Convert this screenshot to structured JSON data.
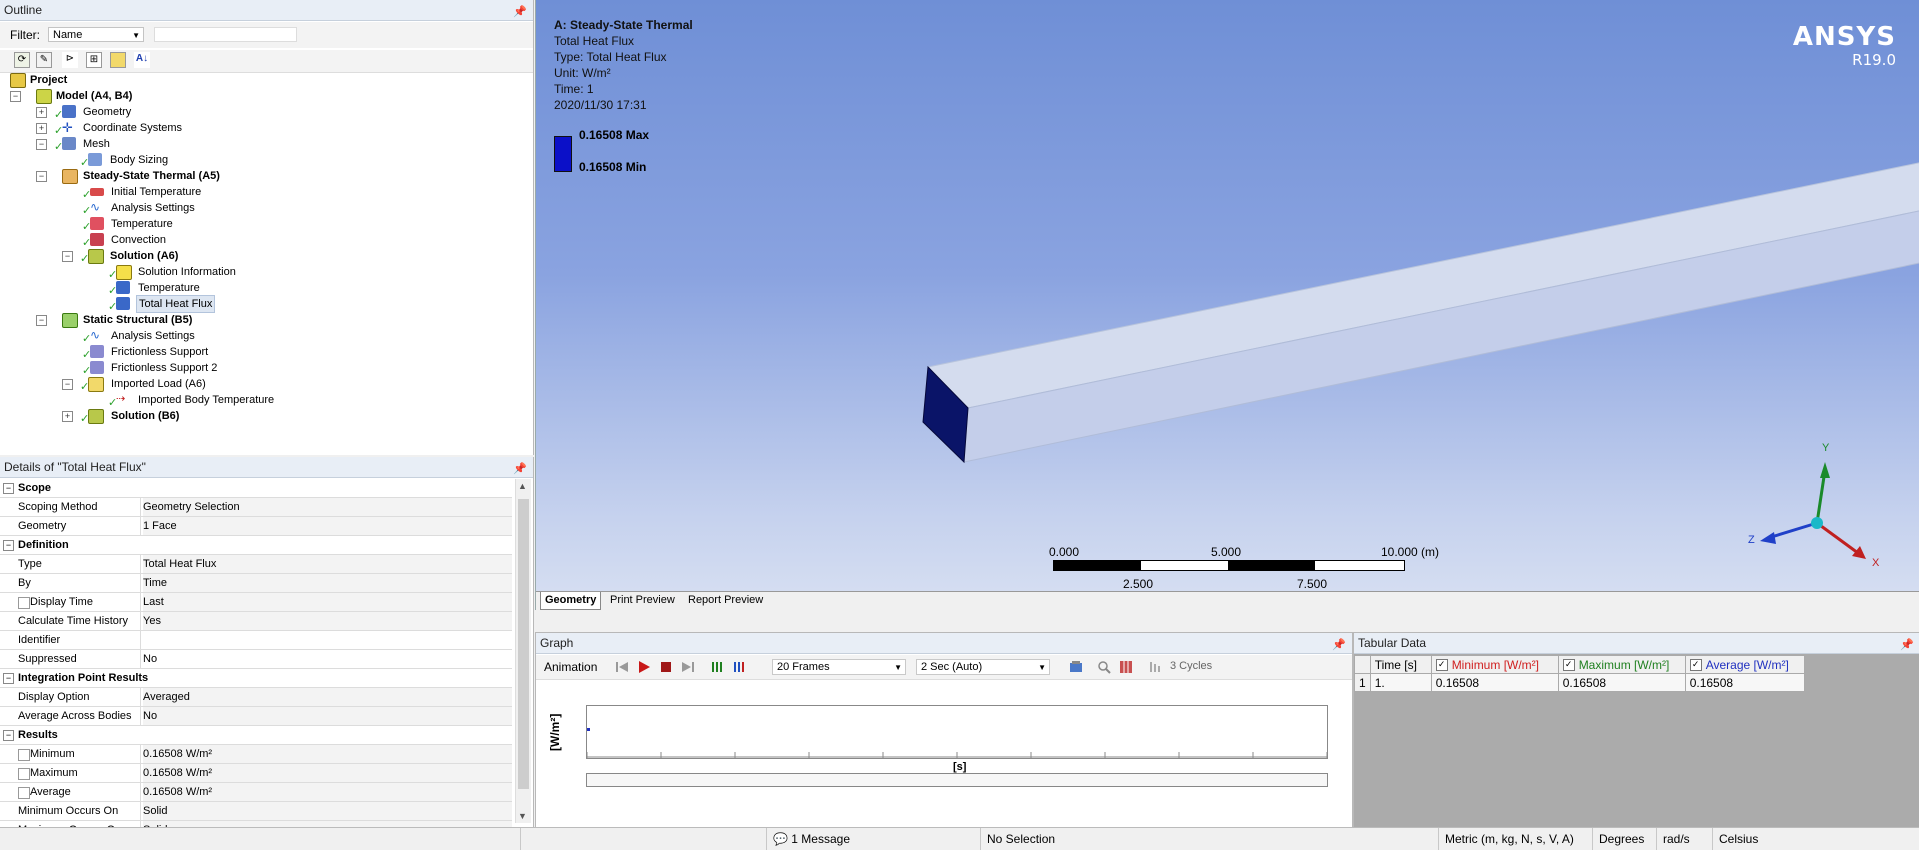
{
  "outline": {
    "title": "Outline",
    "filter_label": "Filter:",
    "filter_value": "Name",
    "tree": [
      {
        "label": "Project",
        "bold": true
      },
      {
        "label": "Model (A4, B4)",
        "bold": true
      },
      {
        "label": "Geometry"
      },
      {
        "label": "Coordinate Systems"
      },
      {
        "label": "Mesh"
      },
      {
        "label": "Body Sizing"
      },
      {
        "label": "Steady-State Thermal (A5)",
        "bold": true
      },
      {
        "label": "Initial Temperature"
      },
      {
        "label": "Analysis Settings"
      },
      {
        "label": "Temperature"
      },
      {
        "label": "Convection"
      },
      {
        "label": "Solution (A6)",
        "bold": true
      },
      {
        "label": "Solution Information"
      },
      {
        "label": "Temperature"
      },
      {
        "label": "Total Heat Flux"
      },
      {
        "label": "Static Structural (B5)",
        "bold": true
      },
      {
        "label": "Analysis Settings"
      },
      {
        "label": "Frictionless Support"
      },
      {
        "label": "Frictionless Support 2"
      },
      {
        "label": "Imported Load (A6)"
      },
      {
        "label": "Imported Body Temperature"
      },
      {
        "label": "Solution (B6)",
        "bold": true
      }
    ]
  },
  "details": {
    "title": "Details of \"Total Heat Flux\"",
    "rows": [
      {
        "section": "Scope"
      },
      {
        "key": "Scoping Method",
        "value": "Geometry Selection"
      },
      {
        "key": "Geometry",
        "value": "1 Face"
      },
      {
        "section": "Definition"
      },
      {
        "key": "Type",
        "value": "Total Heat Flux"
      },
      {
        "key": "By",
        "value": "Time"
      },
      {
        "key": "Display Time",
        "value": "Last",
        "checkbox": true
      },
      {
        "key": "Calculate Time History",
        "value": "Yes"
      },
      {
        "key": "Identifier",
        "value": ""
      },
      {
        "key": "Suppressed",
        "value": "No"
      },
      {
        "section": "Integration Point Results"
      },
      {
        "key": "Display Option",
        "value": "Averaged"
      },
      {
        "key": "Average Across Bodies",
        "value": "No"
      },
      {
        "section": "Results"
      },
      {
        "key": "Minimum",
        "value": "0.16508 W/m²",
        "checkbox": true
      },
      {
        "key": "Maximum",
        "value": "0.16508 W/m²",
        "checkbox": true
      },
      {
        "key": "Average",
        "value": "0.16508 W/m²",
        "checkbox": true
      },
      {
        "key": "Minimum Occurs On",
        "value": "Solid"
      },
      {
        "key": "Maximum Occurs On",
        "value": "Solid"
      }
    ]
  },
  "viewport": {
    "info_lines": [
      "A: Steady-State Thermal",
      "Total Heat Flux",
      "Type: Total Heat Flux",
      "Unit: W/m²",
      "Time: 1",
      "2020/11/30 17:31"
    ],
    "legend_max": "0.16508 Max",
    "legend_min": "0.16508 Min",
    "legend_color": "#0b10c8",
    "logo": "ANSYS",
    "version": "R19.0",
    "scale_top": [
      "0.000",
      "5.000",
      "10.000 (m)"
    ],
    "scale_bottom": [
      "2.500",
      "7.500"
    ],
    "tabs": [
      "Geometry",
      "Print Preview",
      "Report Preview"
    ],
    "axes": {
      "y": "Y",
      "z": "Z",
      "x": "X"
    }
  },
  "graph": {
    "title": "Graph",
    "animation_label": "Animation",
    "frames": "20 Frames",
    "duration": "2 Sec (Auto)",
    "cycles": "3 Cycles",
    "ylabel": "[W/m²]",
    "xlabel": "[s]"
  },
  "tabular": {
    "title": "Tabular Data",
    "headers": [
      "Time [s]",
      "Minimum [W/m²]",
      "Maximum [W/m²]",
      "Average [W/m²]"
    ],
    "header_colors": [
      "#000000",
      "#d02020",
      "#208020",
      "#2030c0"
    ],
    "row_index": "1",
    "row": [
      "1.",
      "0.16508",
      "0.16508",
      "0.16508"
    ]
  },
  "status": {
    "messages": "1 Message",
    "selection": "No Selection",
    "units": "Metric (m, kg, N, s, V, A)",
    "angle": "Degrees",
    "rate": "rad/s",
    "temp": "Celsius"
  }
}
